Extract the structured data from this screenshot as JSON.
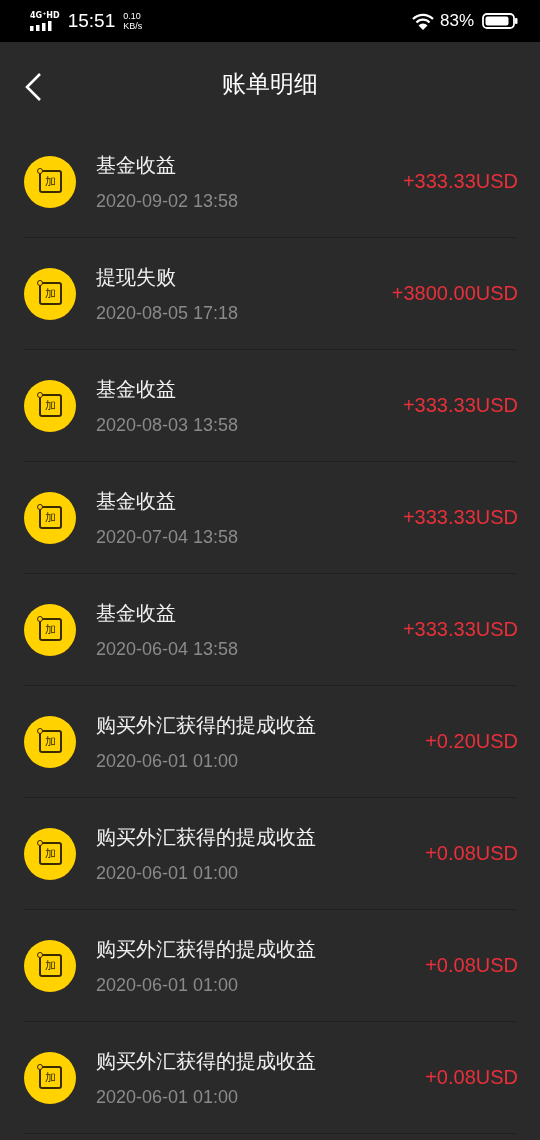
{
  "status_bar": {
    "network": "4G⁺HD",
    "time": "15:51",
    "speed_value": "0.10",
    "speed_unit": "KB/s",
    "battery": "83%"
  },
  "header": {
    "title": "账单明细"
  },
  "records": [
    {
      "icon_label": "加",
      "title": "基金收益",
      "date": "2020-09-02 13:58",
      "amount": "+333.33USD"
    },
    {
      "icon_label": "加",
      "title": "提现失败",
      "date": "2020-08-05 17:18",
      "amount": "+3800.00USD"
    },
    {
      "icon_label": "加",
      "title": "基金收益",
      "date": "2020-08-03 13:58",
      "amount": "+333.33USD"
    },
    {
      "icon_label": "加",
      "title": "基金收益",
      "date": "2020-07-04 13:58",
      "amount": "+333.33USD"
    },
    {
      "icon_label": "加",
      "title": "基金收益",
      "date": "2020-06-04 13:58",
      "amount": "+333.33USD"
    },
    {
      "icon_label": "加",
      "title": "购买外汇获得的提成收益",
      "date": "2020-06-01 01:00",
      "amount": "+0.20USD"
    },
    {
      "icon_label": "加",
      "title": "购买外汇获得的提成收益",
      "date": "2020-06-01 01:00",
      "amount": "+0.08USD"
    },
    {
      "icon_label": "加",
      "title": "购买外汇获得的提成收益",
      "date": "2020-06-01 01:00",
      "amount": "+0.08USD"
    },
    {
      "icon_label": "加",
      "title": "购买外汇获得的提成收益",
      "date": "2020-06-01 01:00",
      "amount": "+0.08USD"
    }
  ]
}
